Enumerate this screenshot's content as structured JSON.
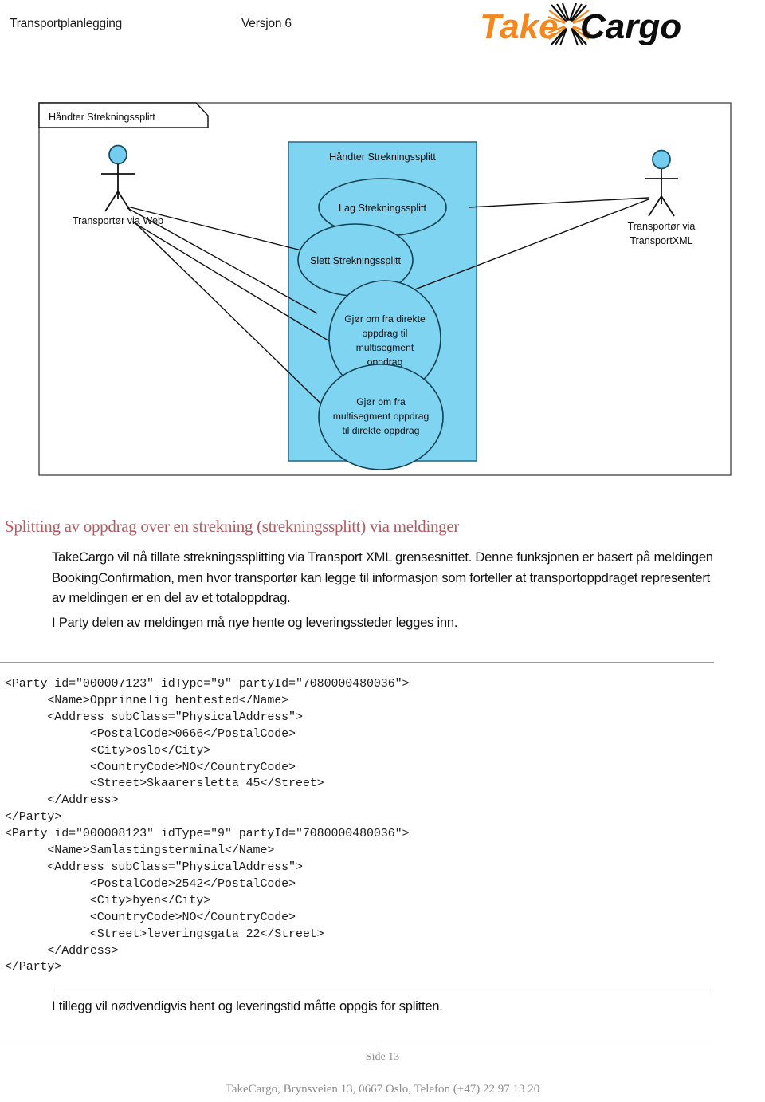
{
  "header": {
    "doc_title": "Transportplanlegging",
    "version": "Versjon 6",
    "logo": {
      "name": "takecargo-logo",
      "text_part1": "Take",
      "text_part2": "Cargo",
      "color_part1": "#F5871F",
      "color_part2": "#0D0D0D"
    }
  },
  "diagram": {
    "type": "uml-use-case",
    "frame_label": "Håndter Strekningssplitt",
    "package_label": "Håndter Strekningssplitt",
    "package_fill": "#7FD4F2",
    "actors": [
      {
        "id": "actor-web",
        "label": "Transportør via Web",
        "label_line1": "Transportør via Web",
        "label_line2": ""
      },
      {
        "id": "actor-xml",
        "label": "Transportør via TransportXML",
        "label_line1": "Transportør via",
        "label_line2": "TransportXML"
      }
    ],
    "use_cases": [
      {
        "id": "uc-lag",
        "lines": [
          "Lag Strekningssplitt"
        ]
      },
      {
        "id": "uc-slett",
        "lines": [
          "Slett Strekningssplitt"
        ]
      },
      {
        "id": "uc-direkte-til-multi",
        "lines": [
          "Gjør om fra direkte",
          "oppdrag til",
          "multisegment",
          "oppdrag"
        ]
      },
      {
        "id": "uc-multi-til-direkte",
        "lines": [
          "Gjør om fra",
          "multisegment oppdrag",
          "til direkte oppdrag"
        ]
      }
    ],
    "associations": [
      {
        "from": "actor-web",
        "to": "uc-lag"
      },
      {
        "from": "actor-web",
        "to": "uc-slett"
      },
      {
        "from": "actor-web",
        "to": "uc-direkte-til-multi"
      },
      {
        "from": "actor-web",
        "to": "uc-multi-til-direkte"
      },
      {
        "from": "actor-xml",
        "to": "uc-lag"
      },
      {
        "from": "actor-xml",
        "to": "uc-slett"
      }
    ]
  },
  "content": {
    "heading": "Splitting av oppdrag over en strekning (strekningssplitt) via meldinger",
    "heading_color": "#B05C62",
    "paragraph_intro": "TakeCargo vil nå tillate strekningssplitting via Transport XML grensesnittet.  Denne funksjonen er basert på meldingen BookingConfirmation, men hvor transportør kan legge til informasjon som forteller at transportoppdraget representert av meldingen er en del av et totaloppdrag.",
    "paragraph_party": "I Party delen av meldingen må nye hente og leveringssteder legges inn.",
    "paragraph_tillegg": "I tillegg vil nødvendigvis hent og leveringstid måtte oppgis for splitten."
  },
  "code_sample": {
    "language": "xml",
    "text": "<Party id=\"000007123\" idType=\"9\" partyId=\"7080000480036\">\n      <Name>Opprinnelig hentested</Name>\n      <Address subClass=\"PhysicalAddress\">\n            <PostalCode>0666</PostalCode>\n            <City>oslo</City>\n            <CountryCode>NO</CountryCode>\n            <Street>Skaarersletta 45</Street>\n      </Address>\n</Party>\n<Party id=\"000008123\" idType=\"9\" partyId=\"7080000480036\">\n      <Name>Samlastingsterminal</Name>\n      <Address subClass=\"PhysicalAddress\">\n            <PostalCode>2542</PostalCode>\n            <City>byen</City>\n            <CountryCode>NO</CountryCode>\n            <Street>leveringsgata 22</Street>\n      </Address>\n</Party>",
    "parties": [
      {
        "id": "000007123",
        "idType": "9",
        "partyId": "7080000480036",
        "name": "Opprinnelig hentested",
        "address": {
          "subClass": "PhysicalAddress",
          "PostalCode": "0666",
          "City": "oslo",
          "CountryCode": "NO",
          "Street": "Skaarersletta 45"
        }
      },
      {
        "id": "000008123",
        "idType": "9",
        "partyId": "7080000480036",
        "name": "Samlastingsterminal",
        "address": {
          "subClass": "PhysicalAddress",
          "PostalCode": "2542",
          "City": "byen",
          "CountryCode": "NO",
          "Street": "leveringsgata 22"
        }
      }
    ]
  },
  "footer": {
    "page_label": "Side 13",
    "address_line": "TakeCargo, Brynsveien 13, 0667 Oslo, Telefon (+47)  22 97 13 20"
  }
}
